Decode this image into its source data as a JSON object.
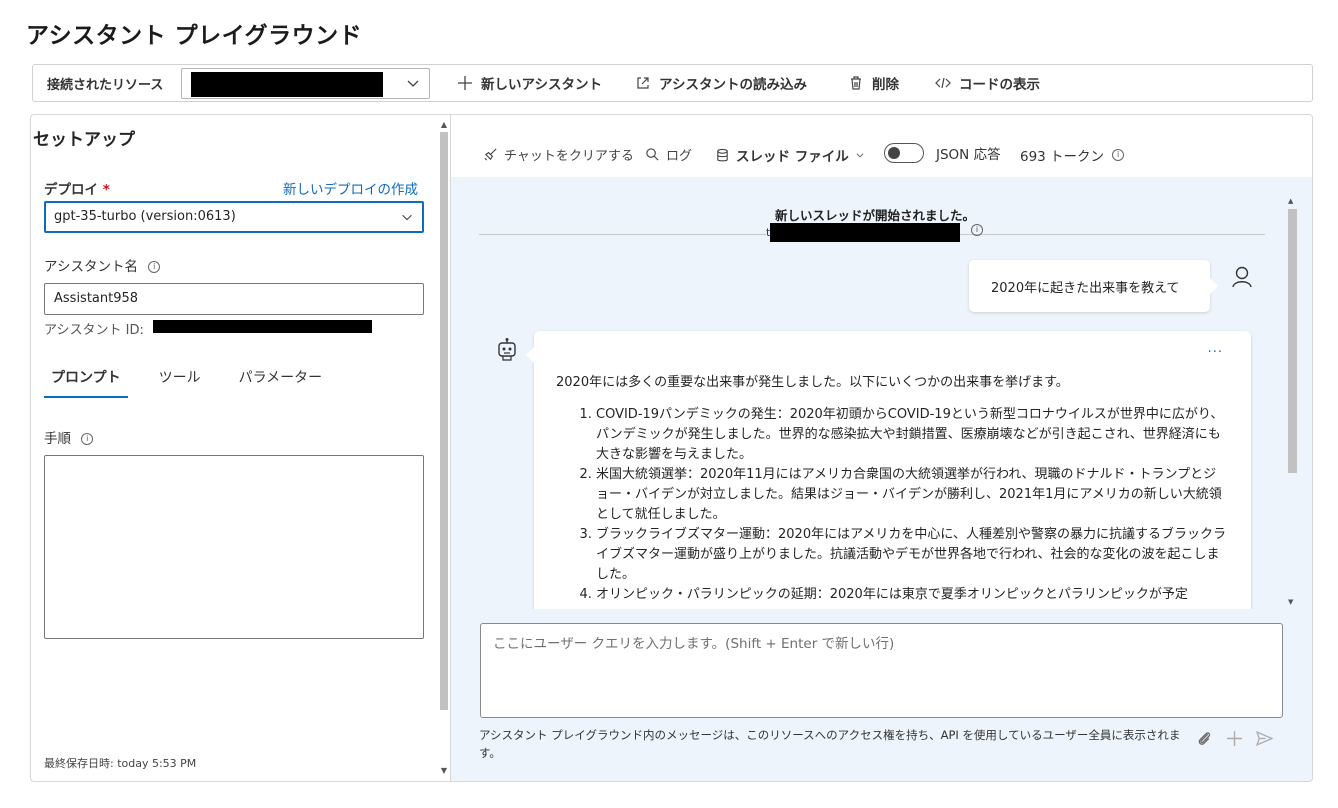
{
  "page": {
    "title": "アシスタント プレイグラウンド"
  },
  "toolbar": {
    "resource_label": "接続されたリソース",
    "new_assistant": "新しいアシスタント",
    "load_assistant": "アシスタントの読み込み",
    "delete": "削除",
    "view_code": "コードの表示"
  },
  "setup": {
    "title": "セットアップ",
    "deploy_label": "デプロイ",
    "required_mark": "*",
    "new_deploy_link": "新しいデプロイの作成",
    "deploy_value": "gpt-35-turbo (version:0613)",
    "assistant_name_label": "アシスタント名",
    "assistant_name_value": "Assistant958",
    "assistant_id_label": "アシスタント ID:",
    "tabs": [
      "プロンプト",
      "ツール",
      "パラメーター"
    ],
    "instructions_label": "手順",
    "last_saved": "最終保存日時: today 5:53 PM"
  },
  "chat": {
    "clear_chat": "チャットをクリアする",
    "logs": "ログ",
    "thread_files": "スレッド ファイル",
    "json_response": "JSON 応答",
    "tokens": "693 トークン",
    "thread_started": "新しいスレッドが開始されました。",
    "thread_prefix": "t",
    "user_message": "2020年に起きた出来事を教えて",
    "more": "···",
    "bot_intro": "2020年には多くの重要な出来事が発生しました。以下にいくつかの出来事を挙げます。",
    "bot_items": [
      "COVID-19パンデミックの発生：2020年初頭からCOVID-19という新型コロナウイルスが世界中に広がり、パンデミックが発生しました。世界的な感染拡大や封鎖措置、医療崩壊などが引き起こされ、世界経済にも大きな影響を与えました。",
      "米国大統領選挙：2020年11月にはアメリカ合衆国の大統領選挙が行われ、現職のドナルド・トランプとジョー・バイデンが対立しました。結果はジョー・バイデンが勝利し、2021年1月にアメリカの新しい大統領として就任しました。",
      "ブラックライブズマター運動：2020年にはアメリカを中心に、人種差別や警察の暴力に抗議するブラックライブズマター運動が盛り上がりました。抗議活動やデモが世界各地で行われ、社会的な変化の波を起こしました。",
      "オリンピック・パラリンピックの延期：2020年には東京で夏季オリンピックとパラリンピックが予定"
    ],
    "input_placeholder": "ここにユーザー クエリを入力します。(Shift + Enter で新しい行)",
    "disclaimer": "アシスタント プレイグラウンド内のメッセージは、このリソースへのアクセス権を持ち、API を使用しているユーザー全員に表示されます。"
  },
  "colors": {
    "accent": "#0f6cbd",
    "chat_bg": "#eef4fb",
    "required": "#c50f1f"
  }
}
